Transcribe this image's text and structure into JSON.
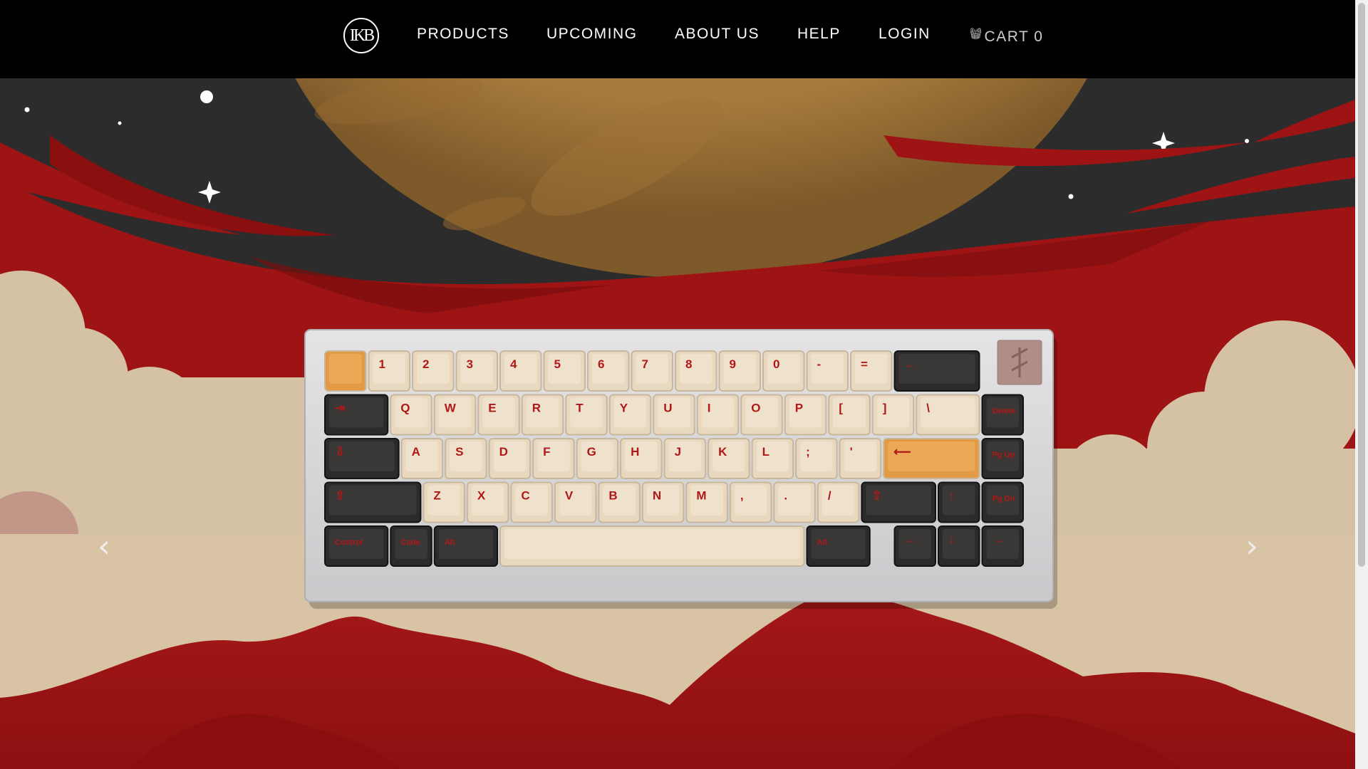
{
  "header": {
    "logo_text": "IKB",
    "nav": [
      {
        "label": "PRODUCTS"
      },
      {
        "label": "UPCOMING"
      },
      {
        "label": "ABOUT US"
      },
      {
        "label": "HELP"
      },
      {
        "label": "LOGIN"
      }
    ],
    "cart_icon": "basket-icon",
    "cart_label": "CART 0"
  },
  "hero": {
    "prev_icon": "chevron-left-icon",
    "next_icon": "chevron-right-icon",
    "keyboard": {
      "side_keys": [
        "Delete",
        "Pg Up",
        "Pg Dn"
      ],
      "modifiers": [
        "Control",
        "Code",
        "Alt",
        "Alt"
      ]
    }
  },
  "colors": {
    "nav_bg": "#000000",
    "sky": "#2b2b2b",
    "planet": "#b8894a",
    "red": "#9e1414",
    "cloud": "#d6c2a4",
    "keycap_cream": "#e8d8bf",
    "keycap_dark": "#2c2a2a",
    "accent_orange": "#e39a44",
    "legend_red": "#b01818"
  }
}
